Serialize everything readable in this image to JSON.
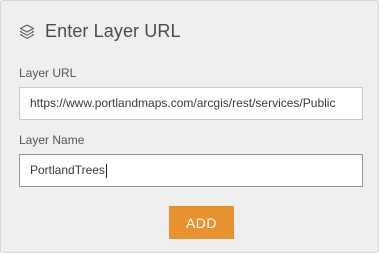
{
  "panel": {
    "title": "Enter Layer URL",
    "title_icon": "layers-icon"
  },
  "layer_url": {
    "label": "Layer URL",
    "value": "https://www.portlandmaps.com/arcgis/rest/services/Public"
  },
  "layer_name": {
    "label": "Layer Name",
    "value": "PortlandTrees"
  },
  "actions": {
    "add_label": "ADD"
  },
  "colors": {
    "panel_background": "#efefef",
    "accent_button": "#e8912f",
    "title_text": "#4c4c4c"
  }
}
